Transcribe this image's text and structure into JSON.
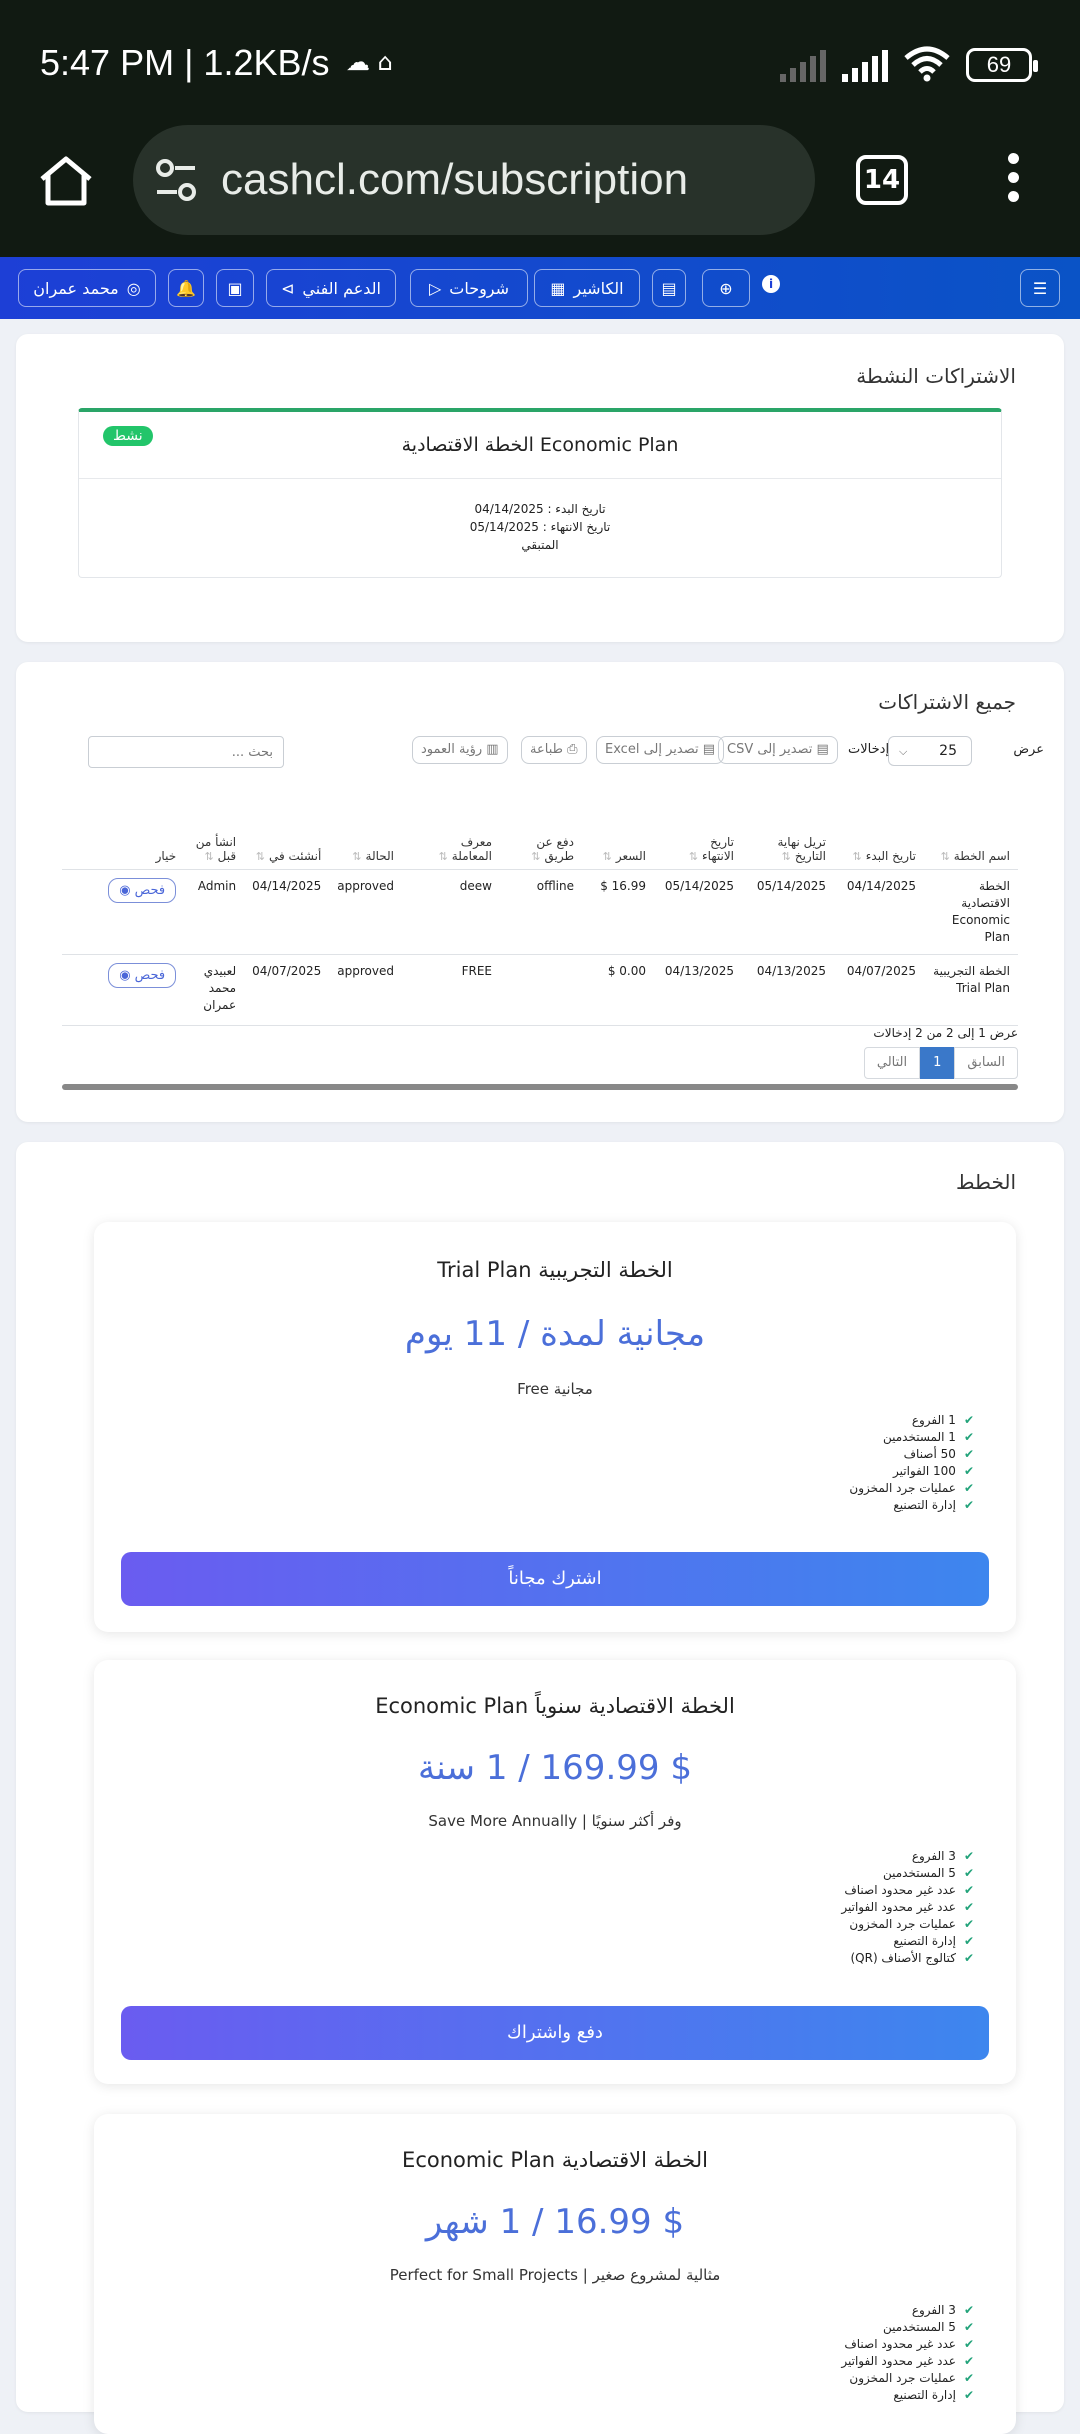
{
  "status_bar": {
    "time": "5:47 PM | 1.2KB/s",
    "battery": "69"
  },
  "browser": {
    "url": "cashcl.com/subscription",
    "tab_count": "14"
  },
  "nav": {
    "user": "محمد عمران",
    "support": "الدعم الفني",
    "tutorials": "شروحات",
    "cashier": "الكاشير"
  },
  "active_subs": {
    "title": "الاشتراكات النشطة",
    "badge": "نشط",
    "plan_name": "الخطة الاقتصادية Economic Plan",
    "start": "تاريخ البدء : 04/14/2025",
    "end": "تاريخ الانتهاء : 05/14/2025",
    "remaining": "المتبقي"
  },
  "all_subs": {
    "title": "جميع الاشتراكات",
    "show": "عرض",
    "entries_value": "25",
    "entries": "إدخالات",
    "export_csv": "تصدير إلى CSV",
    "export_excel": "تصدير إلى Excel",
    "print": "طباعة",
    "columns": "رؤية العمود",
    "search_placeholder": "بحث ...",
    "columns_headers": [
      "اسم الخطة",
      "تاريخ البدء",
      "تريل نهاية التاريخ",
      "تاريخ الانتهاء",
      "السعر",
      "دفع عن طريق",
      "معرف المعاملة",
      "الحالة",
      "أنشئت في",
      "انشأ من قبل",
      "خيار"
    ],
    "rows": [
      {
        "plan": "الخطة الاقتصادية Economic Plan",
        "start": "04/14/2025",
        "trial_end": "05/14/2025",
        "end": "05/14/2025",
        "price": "16.99 $",
        "pay": "offline",
        "txn": "deew",
        "status": "approved",
        "created": "04/14/2025",
        "by": "Admin",
        "action": "فحص"
      },
      {
        "plan": "الخطة التجريبية Trial Plan",
        "start": "04/07/2025",
        "trial_end": "04/13/2025",
        "end": "04/13/2025",
        "price": "0.00 $",
        "pay": "",
        "txn": "FREE",
        "status": "approved",
        "created": "04/07/2025",
        "by": "لعبيدي محمد عمران",
        "action": "فحص"
      }
    ],
    "info": "عرض 1 إلى 2 من 2 إدخالات",
    "prev": "السابق",
    "page": "1",
    "next": "التالي"
  },
  "plans": {
    "title": "الخطط",
    "items": [
      {
        "name": "الخطة التجريبية Trial Plan",
        "price": "مجانية لمدة / 11 يوم",
        "desc": "مجانية Free",
        "features": [
          "1 الفروع",
          "1 المستخدمين",
          "50 أصناف",
          "100 الفواتير",
          "عمليات جرد المخزون",
          "إدارة التصنيع"
        ],
        "button": "اشترك مجاناً"
      },
      {
        "name": "الخطة الاقتصادية سنوياً Economic Plan",
        "price": "$ 169.99 / 1 سنة",
        "desc": "وفر أكثر سنويًا | Save More Annually",
        "features": [
          "3 الفروع",
          "5 المستخدمين",
          "عدد غير محدود اصناف",
          "عدد غير محدود الفواتير",
          "عمليات جرد المخزون",
          "إدارة التصنيع",
          "كتالوج الأصناف (QR)"
        ],
        "button": "دفع واشتراك"
      },
      {
        "name": "الخطة الاقتصادية Economic Plan",
        "price": "$ 16.99 / 1 شهر",
        "desc": "مثالية لمشروع صغير | Perfect for Small Projects",
        "features": [
          "3 الفروع",
          "5 المستخدمين",
          "عدد غير محدود اصناف",
          "عدد غير محدود الفواتير",
          "عمليات جرد المخزون",
          "إدارة التصنيع"
        ]
      }
    ]
  }
}
